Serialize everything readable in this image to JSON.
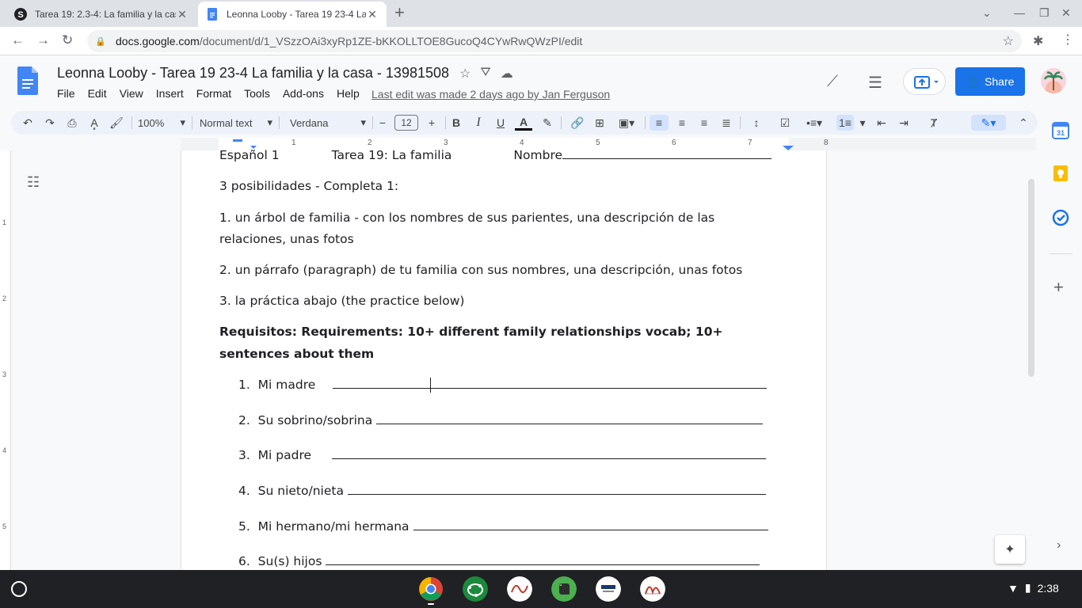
{
  "browser": {
    "tabs": [
      {
        "title": "Tarea 19: 2.3-4: La familia y la casa",
        "active": false
      },
      {
        "title": "Leonna Looby - Tarea 19 23-4 La familia y la casa",
        "active": true
      }
    ],
    "url_host": "docs.google.com",
    "url_path": "/document/d/1_VSzzOAi3xyRp1ZE-bKKOLLTOE8GucoQ4CYwRwQWzPI/edit"
  },
  "doc": {
    "title": "Leonna Looby - Tarea 19 23-4  La familia y la casa - 13981508",
    "menus": [
      "File",
      "Edit",
      "View",
      "Insert",
      "Format",
      "Tools",
      "Add-ons",
      "Help"
    ],
    "last_edit": "Last edit was made 2 days ago by Jan Ferguson",
    "share_label": "Share"
  },
  "toolbar": {
    "zoom": "100%",
    "style": "Normal text",
    "font": "Verdana",
    "font_size": "12"
  },
  "ruler": {
    "numbers": [
      "1",
      "2",
      "3",
      "4",
      "5",
      "6",
      "7",
      "8"
    ]
  },
  "vruler": {
    "numbers": [
      "1",
      "2",
      "3",
      "4",
      "5"
    ]
  },
  "content": {
    "header_left": "Español 1",
    "header_mid": "Tarea 19: La familia",
    "header_right": "Nombre",
    "intro": "3 posibilidades - Completa 1:",
    "opt1_a": "1. un árbol de familia - con los nombres de sus parientes, una descripción de las",
    "opt1_b": "relaciones, unas fotos",
    "opt2": "2.  un párrafo (paragraph) de tu familia con sus nombres, una descripción, unas fotos",
    "opt3": "3.  la práctica abajo (the practice below)",
    "req_a": "Requisitos:  Requirements:  10+ different family relationships vocab; 10+",
    "req_b": "sentences about them",
    "items": [
      {
        "num": "1.",
        "text": "Mi madre"
      },
      {
        "num": "2.",
        "text": "Su sobrino/sobrina"
      },
      {
        "num": "3.",
        "text": "Mi padre"
      },
      {
        "num": "4.",
        "text": "Su nieto/nieta"
      },
      {
        "num": "5.",
        "text": "Mi hermano/mi hermana"
      },
      {
        "num": "6.",
        "text": "Su(s) hijos"
      }
    ]
  },
  "system": {
    "time": "2:38"
  },
  "colors": {
    "accent": "#1a73e8",
    "docs_blue": "#4285f4"
  }
}
